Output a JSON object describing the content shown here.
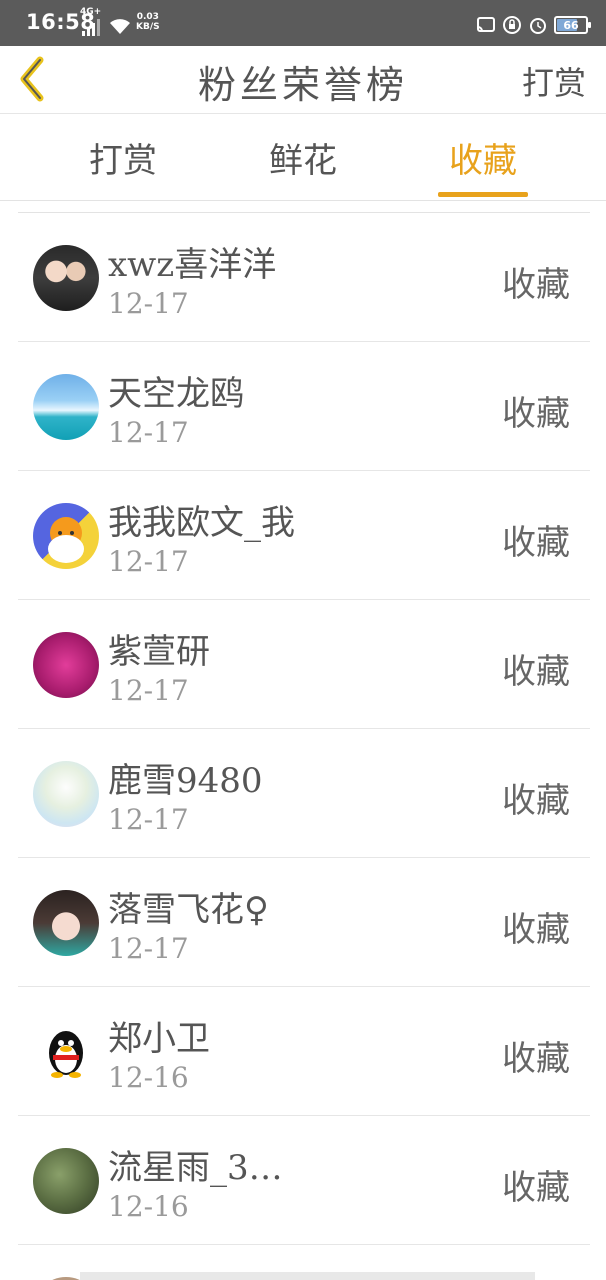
{
  "status_bar": {
    "time": "16:58",
    "network": "4G+",
    "speed_value": "0.03",
    "speed_unit": "KB/S",
    "battery": "66"
  },
  "header": {
    "title": "粉丝荣誉榜",
    "action_label": "打赏"
  },
  "tabs": [
    {
      "label": "打赏",
      "active": false
    },
    {
      "label": "鲜花",
      "active": false
    },
    {
      "label": "收藏",
      "active": true
    }
  ],
  "colors": {
    "accent": "#e8a21c",
    "status_bar": "#5b5b5b",
    "text": "#555555",
    "date": "#9a9a9a"
  },
  "items": [
    {
      "name": "xwz喜洋洋",
      "date": "12-17",
      "action": "收藏"
    },
    {
      "name": "天空龙鸥",
      "date": "12-17",
      "action": "收藏"
    },
    {
      "name": "我我欧文_我",
      "date": "12-17",
      "action": "收藏"
    },
    {
      "name": "紫萱研",
      "date": "12-17",
      "action": "收藏"
    },
    {
      "name": "鹿雪9480",
      "date": "12-17",
      "action": "收藏"
    },
    {
      "name": "落雪飞花♀",
      "date": "12-17",
      "action": "收藏"
    },
    {
      "name": "郑小卫",
      "date": "12-16",
      "action": "收藏"
    },
    {
      "name": "流星雨_3…",
      "date": "12-16",
      "action": "收藏"
    }
  ]
}
